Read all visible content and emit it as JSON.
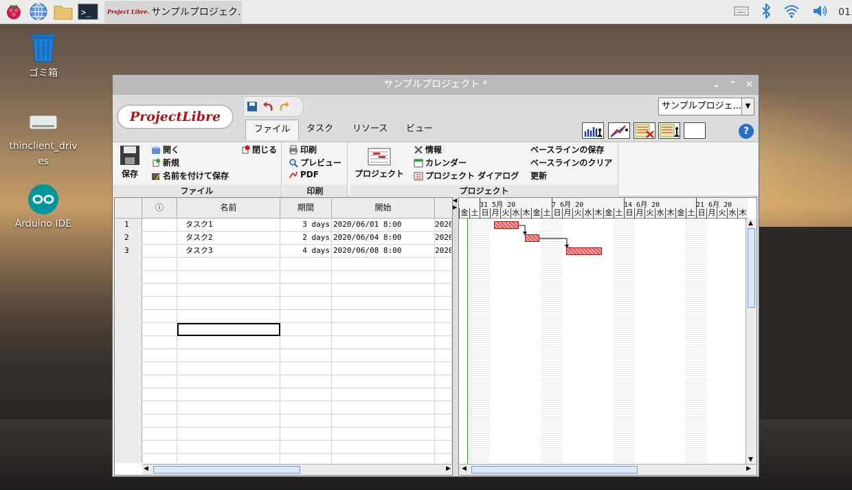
{
  "taskbar": {
    "task_title": "サンプルプロジェク...",
    "task_logo": "Project Libre.",
    "clock": "01",
    "tray_icons": [
      "keyboard-icon",
      "bluetooth-icon",
      "wifi-icon",
      "volume-icon"
    ]
  },
  "desktop": {
    "icons": [
      {
        "label": "ゴミ箱",
        "icon": "trash-icon"
      },
      {
        "label": "thinclient_drives",
        "icon": "drive-icon"
      },
      {
        "label": "Arduino IDE",
        "icon": "arduino-icon"
      }
    ]
  },
  "window": {
    "title": "サンプルプロジェクト *",
    "project_selector": "サンプルプロジェ...",
    "logo": "ProjectLibre"
  },
  "tabs": [
    "ファイル",
    "タスク",
    "リソース",
    "ビュー"
  ],
  "ribbon": {
    "file": {
      "label": "ファイル",
      "save": "保存",
      "open": "開く",
      "close": "閉じる",
      "new": "新規",
      "save_as": "名前を付けて保存"
    },
    "print": {
      "label": "印刷",
      "print": "印刷",
      "preview": "プレビュー",
      "pdf": "PDF"
    },
    "project": {
      "label": "プロジェクト",
      "project": "プロジェクト",
      "info": "情報",
      "calendar": "カレンダー",
      "project_dialog": "プロジェクト ダイアログ",
      "save_baseline": "ベースラインの保存",
      "clear_baseline": "ベースラインのクリア",
      "update": "更新"
    }
  },
  "table": {
    "headers": {
      "indicator": "ⓘ",
      "name": "名前",
      "duration": "期間",
      "start": "開始"
    },
    "rows": [
      {
        "num": "1",
        "name": "タスク1",
        "duration": "3 days",
        "start": "2020/06/01 8:00",
        "end": "2020"
      },
      {
        "num": "2",
        "name": "タスク2",
        "duration": "2 days",
        "start": "2020/06/04 8:00",
        "end": "2020"
      },
      {
        "num": "3",
        "name": "タスク3",
        "duration": "4 days",
        "start": "2020/06/08 8:00",
        "end": "2020"
      }
    ]
  },
  "gantt": {
    "weeks": [
      "31 5月 20",
      "7 6月 20",
      "14 6月 20",
      "21 6月 20"
    ],
    "days": [
      "金",
      "土",
      "日",
      "月",
      "火",
      "水",
      "木",
      "金",
      "土",
      "日",
      "月",
      "火",
      "水",
      "木",
      "金",
      "土",
      "日",
      "月",
      "火",
      "水",
      "木",
      "金",
      "土",
      "日",
      "月",
      "火",
      "水",
      "木"
    ]
  },
  "colors": {
    "bar": "#e25a5a",
    "logo_red": "#b0121a",
    "accent_blue": "#2a6fc9"
  }
}
